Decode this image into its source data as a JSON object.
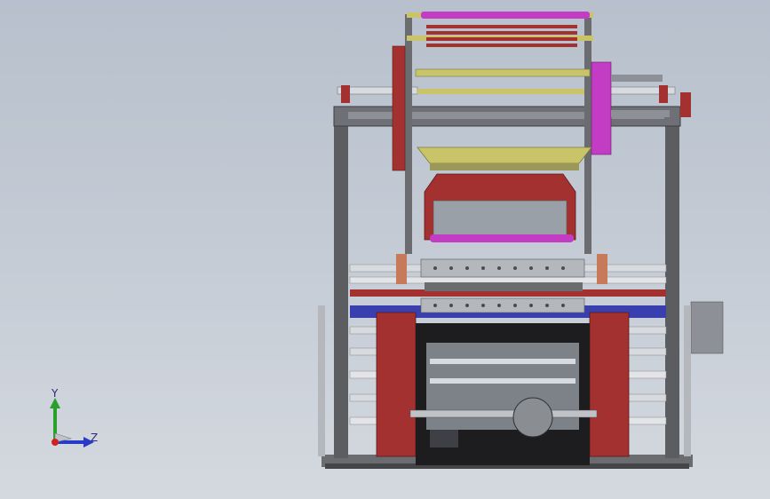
{
  "viewport": {
    "background_top": "#b7c0cc",
    "background_bottom": "#d4d9df"
  },
  "model": {
    "colors": {
      "frame": "#5b5d61",
      "frame_light": "#8d9096",
      "rollers": "#d7dadf",
      "red": "#a3312f",
      "yellow": "#c9c46a",
      "magenta": "#c23cc4",
      "blue": "#3a3fb0",
      "dark": "#1d1d20",
      "teal": "#3aa6a0"
    }
  },
  "triad": {
    "y_label": "Y",
    "z_label": "Z",
    "y_color": "#2aa02a",
    "z_color": "#2a3ac8",
    "origin_color": "#d02020"
  }
}
